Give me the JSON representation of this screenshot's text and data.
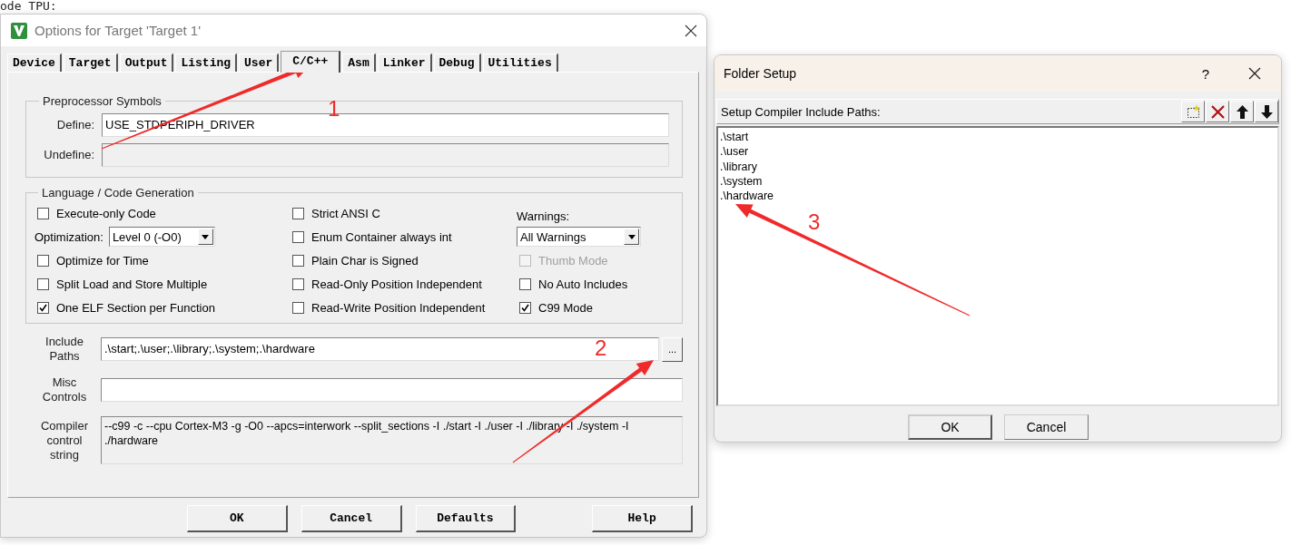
{
  "background_text": "ode TPU:",
  "options_dialog": {
    "title": "Options for Target 'Target 1'",
    "tabs": [
      {
        "label": "Device",
        "selected": false
      },
      {
        "label": "Target",
        "selected": false
      },
      {
        "label": "Output",
        "selected": false
      },
      {
        "label": "Listing",
        "selected": false
      },
      {
        "label": "User",
        "selected": false
      },
      {
        "label": "C/C++",
        "selected": true
      },
      {
        "label": "Asm",
        "selected": false
      },
      {
        "label": "Linker",
        "selected": false
      },
      {
        "label": "Debug",
        "selected": false
      },
      {
        "label": "Utilities",
        "selected": false
      }
    ],
    "preprocessor": {
      "title": "Preprocessor Symbols",
      "fields": [
        {
          "label": "Define:",
          "value": "USE_STDPERIPH_DRIVER",
          "disabled": false
        },
        {
          "label": "Undefine:",
          "disabled": true
        }
      ]
    },
    "language": {
      "title": "Language / Code Generation",
      "columns": [
        [
          {
            "kind": "checkbox",
            "label": "Execute-only Code",
            "checked": false,
            "disabled": false
          },
          {
            "kind": "select",
            "label": "Optimization:",
            "value": "Level 0 (-O0)"
          },
          {
            "kind": "checkbox",
            "label": "Optimize for Time",
            "checked": false,
            "disabled": false
          },
          {
            "kind": "checkbox",
            "label": "Split Load and Store Multiple",
            "checked": false,
            "disabled": false
          },
          {
            "kind": "checkbox",
            "label": "One ELF Section per Function",
            "checked": true,
            "disabled": false
          }
        ],
        [
          {
            "kind": "checkbox",
            "label": "Strict ANSI C",
            "checked": false,
            "disabled": false
          },
          {
            "kind": "checkbox",
            "label": "Enum Container always int",
            "checked": false,
            "disabled": false
          },
          {
            "kind": "checkbox",
            "label": "Plain Char is Signed",
            "checked": false,
            "disabled": false
          },
          {
            "kind": "checkbox",
            "label": "Read-Only Position Independent",
            "checked": false,
            "disabled": false
          },
          {
            "kind": "checkbox",
            "label": "Read-Write Position Independent",
            "checked": false,
            "disabled": false
          }
        ],
        [
          {
            "kind": "heading",
            "label": "Warnings:"
          },
          {
            "kind": "select",
            "value": "All Warnings"
          },
          {
            "kind": "checkbox",
            "label": "Thumb Mode",
            "checked": false,
            "disabled": true
          },
          {
            "kind": "checkbox",
            "label": "No Auto Includes",
            "checked": false,
            "disabled": false
          },
          {
            "kind": "checkbox",
            "label": "C99 Mode",
            "checked": true,
            "disabled": false
          }
        ]
      ]
    },
    "include_paths": {
      "label": "Include Paths",
      "value": ".\\start;.\\user;.\\library;.\\system;.\\hardware",
      "browse": "..."
    },
    "misc_controls": {
      "label": "Misc Controls"
    },
    "compiler_string": {
      "label": "Compiler control string",
      "value": "--c99 -c --cpu Cortex-M3 -g -O0 --apcs=interwork --split_sections -I ./start -I ./user -I ./library -I ./system -I ./hardware"
    },
    "buttons": [
      "OK",
      "Cancel",
      "Defaults",
      "Help"
    ]
  },
  "folder_setup": {
    "title": "Folder Setup",
    "help": "?",
    "list_title": "Setup Compiler Include Paths:",
    "paths": [
      ".\\start",
      ".\\user",
      ".\\library",
      ".\\system",
      ".\\hardware"
    ],
    "buttons": [
      {
        "label": "OK",
        "default": true
      },
      {
        "label": "Cancel",
        "default": false
      }
    ]
  },
  "annotations": [
    "1",
    "2",
    "3"
  ]
}
